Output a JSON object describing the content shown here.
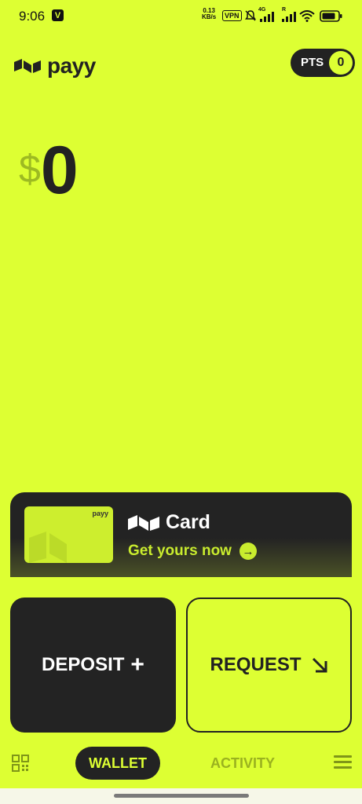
{
  "status_bar": {
    "time": "9:06",
    "notification_glyph": "V",
    "net_speed_value": "0.13",
    "net_speed_unit": "KB/s",
    "vpn_label": "VPN",
    "net_type": "4G",
    "roaming": "R"
  },
  "header": {
    "logo_text": "payy",
    "points_label": "PTS",
    "points_value": "0"
  },
  "balance": {
    "currency": "$",
    "amount": "0"
  },
  "card_promo": {
    "thumb_logo": "payy",
    "title": "Card",
    "cta": "Get yours now"
  },
  "actions": {
    "deposit_label": "DEPOSIT",
    "request_label": "REQUEST"
  },
  "bottom_nav": {
    "wallet": "WALLET",
    "activity": "ACTIVITY"
  },
  "colors": {
    "accent": "#DDFF33",
    "dark": "#232323"
  }
}
